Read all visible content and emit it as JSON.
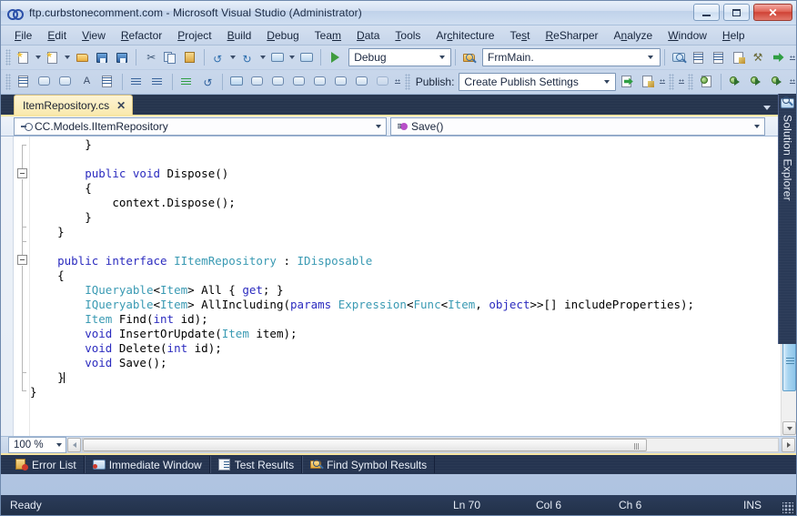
{
  "window": {
    "title": "ftp.curbstonecomment.com - Microsoft Visual Studio (Administrator)",
    "logo_icon": "visual-studio-infinity-logo",
    "minimize_label": "Minimize",
    "maximize_label": "Maximize",
    "close_label": "Close"
  },
  "menu": {
    "items": [
      {
        "label": "File",
        "mnemonic": "F"
      },
      {
        "label": "Edit",
        "mnemonic": "E"
      },
      {
        "label": "View",
        "mnemonic": "V"
      },
      {
        "label": "Refactor",
        "mnemonic": "R"
      },
      {
        "label": "Project",
        "mnemonic": "P"
      },
      {
        "label": "Build",
        "mnemonic": "B"
      },
      {
        "label": "Debug",
        "mnemonic": "D"
      },
      {
        "label": "Team",
        "mnemonic": "m"
      },
      {
        "label": "Data",
        "mnemonic": "D"
      },
      {
        "label": "Tools",
        "mnemonic": "T"
      },
      {
        "label": "Architecture",
        "mnemonic": "c"
      },
      {
        "label": "Test",
        "mnemonic": "s"
      },
      {
        "label": "ReSharper",
        "mnemonic": "R"
      },
      {
        "label": "Analyze",
        "mnemonic": "n"
      },
      {
        "label": "Window",
        "mnemonic": "W"
      },
      {
        "label": "Help",
        "mnemonic": "H"
      }
    ]
  },
  "toolbar": {
    "row1": {
      "new_item_label": "New Item",
      "add_item_label": "Add New Item",
      "open_label": "Open File",
      "save_label": "Save",
      "save_all_label": "Save All",
      "cut_label": "Cut",
      "copy_label": "Copy",
      "paste_label": "Paste",
      "undo_label": "Undo",
      "redo_label": "Redo",
      "navigate_back_label": "Navigate Backward",
      "navigate_forward_label": "Navigate Forward",
      "start_label": "Start Debugging",
      "config_value": "Debug",
      "find_combo_value": "FrmMain.",
      "find_icon_label": "Find in Files",
      "solution_explorer_label": "Solution Explorer",
      "properties_label": "Properties Window",
      "object_browser_label": "Object Browser",
      "toolbox_label": "Toolbox",
      "error_list_label": "Error List",
      "publish_now_label": "Publish Now"
    },
    "row2": {
      "publish_label": "Publish:",
      "publish_value": "Create Publish Settings",
      "comment_label": "Comment Selection",
      "uncomment_label": "Uncomment Selection",
      "indent_label": "Increase Indent",
      "outdent_label": "Decrease Indent",
      "bookmark_label": "Toggle Bookmark",
      "undo_checkout_label": "Undo Checkout"
    },
    "overflow_label": "Toolbar Options"
  },
  "document": {
    "tab_label": "ItemRepository.cs",
    "tab_close_glyph": "✕",
    "tab_list_label": "Active Files"
  },
  "navbar": {
    "type_value": "CC.Models.IItemRepository",
    "type_icon": "interface-icon",
    "member_value": "Save()",
    "member_icon": "method-icon"
  },
  "editor": {
    "lines": [
      {
        "indent": 8,
        "tokens": [
          {
            "t": "}",
            "c": "pun"
          }
        ]
      },
      {
        "indent": 0,
        "tokens": []
      },
      {
        "indent": 8,
        "tokens": [
          {
            "t": "public",
            "c": "kw"
          },
          {
            "t": " ",
            "c": "pun"
          },
          {
            "t": "void",
            "c": "kw"
          },
          {
            "t": " Dispose()",
            "c": "id"
          }
        ]
      },
      {
        "indent": 8,
        "tokens": [
          {
            "t": "{",
            "c": "pun"
          }
        ]
      },
      {
        "indent": 12,
        "tokens": [
          {
            "t": "context.Dispose();",
            "c": "id"
          }
        ]
      },
      {
        "indent": 8,
        "tokens": [
          {
            "t": "}",
            "c": "pun"
          }
        ]
      },
      {
        "indent": 4,
        "tokens": [
          {
            "t": "}",
            "c": "pun"
          }
        ]
      },
      {
        "indent": 0,
        "tokens": []
      },
      {
        "indent": 4,
        "tokens": [
          {
            "t": "public",
            "c": "kw"
          },
          {
            "t": " ",
            "c": "pun"
          },
          {
            "t": "interface",
            "c": "kw"
          },
          {
            "t": " ",
            "c": "pun"
          },
          {
            "t": "IItemRepository",
            "c": "typ"
          },
          {
            "t": " : ",
            "c": "pun"
          },
          {
            "t": "IDisposable",
            "c": "typ"
          }
        ]
      },
      {
        "indent": 4,
        "tokens": [
          {
            "t": "{",
            "c": "pun"
          }
        ]
      },
      {
        "indent": 8,
        "tokens": [
          {
            "t": "IQueryable",
            "c": "typ"
          },
          {
            "t": "<",
            "c": "pun"
          },
          {
            "t": "Item",
            "c": "typ"
          },
          {
            "t": "> All { ",
            "c": "pun"
          },
          {
            "t": "get",
            "c": "kw"
          },
          {
            "t": "; }",
            "c": "pun"
          }
        ]
      },
      {
        "indent": 8,
        "tokens": [
          {
            "t": "IQueryable",
            "c": "typ"
          },
          {
            "t": "<",
            "c": "pun"
          },
          {
            "t": "Item",
            "c": "typ"
          },
          {
            "t": "> AllIncluding(",
            "c": "pun"
          },
          {
            "t": "params",
            "c": "kw"
          },
          {
            "t": " ",
            "c": "pun"
          },
          {
            "t": "Expression",
            "c": "typ"
          },
          {
            "t": "<",
            "c": "pun"
          },
          {
            "t": "Func",
            "c": "typ"
          },
          {
            "t": "<",
            "c": "pun"
          },
          {
            "t": "Item",
            "c": "typ"
          },
          {
            "t": ", ",
            "c": "pun"
          },
          {
            "t": "object",
            "c": "kw"
          },
          {
            "t": ">>[] includeProperties);",
            "c": "pun"
          }
        ]
      },
      {
        "indent": 8,
        "tokens": [
          {
            "t": "Item",
            "c": "typ"
          },
          {
            "t": " Find(",
            "c": "pun"
          },
          {
            "t": "int",
            "c": "kw"
          },
          {
            "t": " id);",
            "c": "pun"
          }
        ]
      },
      {
        "indent": 8,
        "tokens": [
          {
            "t": "void",
            "c": "kw"
          },
          {
            "t": " InsertOrUpdate(",
            "c": "pun"
          },
          {
            "t": "Item",
            "c": "typ"
          },
          {
            "t": " item);",
            "c": "pun"
          }
        ]
      },
      {
        "indent": 8,
        "tokens": [
          {
            "t": "void",
            "c": "kw"
          },
          {
            "t": " Delete(",
            "c": "pun"
          },
          {
            "t": "int",
            "c": "kw"
          },
          {
            "t": " id);",
            "c": "pun"
          }
        ]
      },
      {
        "indent": 8,
        "tokens": [
          {
            "t": "void",
            "c": "kw"
          },
          {
            "t": " Save();",
            "c": "pun"
          }
        ]
      },
      {
        "indent": 4,
        "tokens": [
          {
            "t": "}",
            "c": "pun"
          },
          {
            "t": "CURSOR",
            "c": "cursor"
          }
        ]
      },
      {
        "indent": 0,
        "tokens": [
          {
            "t": "}",
            "c": "pun"
          }
        ]
      }
    ]
  },
  "zoom_control": {
    "value": "100 %"
  },
  "bottom_tabs": [
    {
      "label": "Error List",
      "icon": "error-list-icon"
    },
    {
      "label": "Immediate Window",
      "icon": "immediate-window-icon"
    },
    {
      "label": "Test Results",
      "icon": "test-results-icon"
    },
    {
      "label": "Find Symbol Results",
      "icon": "find-symbol-results-icon"
    }
  ],
  "status": {
    "message": "Ready",
    "line": "Ln 70",
    "column": "Col 6",
    "character": "Ch 6",
    "insert_mode": "INS"
  },
  "solution_explorer": {
    "label": "Solution Explorer",
    "icon": "solution-explorer-icon"
  },
  "colors": {
    "chrome": "#c3d4ea",
    "docwell": "#26354e",
    "tab_active": "#faeab0",
    "accent_gold": "#f8e6a3",
    "keyword": "#2b2bbf",
    "type": "#3a9ab3",
    "status_bg": "#2b3c5a"
  }
}
